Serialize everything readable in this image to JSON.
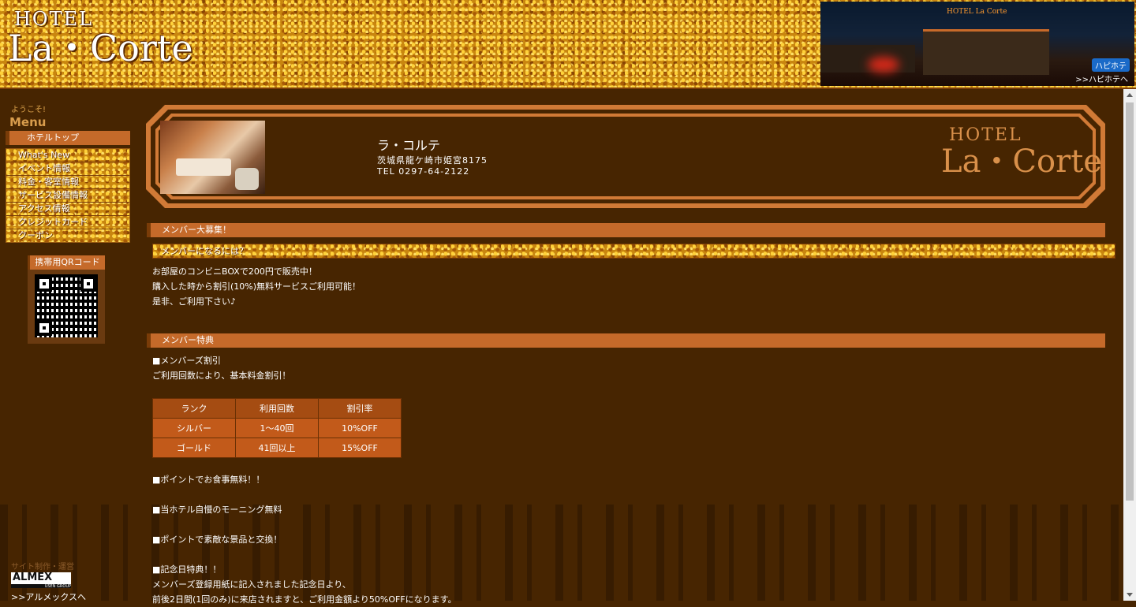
{
  "header": {
    "logo_line1": "HOTEL",
    "logo_line2": "La・Corte",
    "banner_sign": "HOTEL La Corte",
    "banner_badge": "ハピホテ",
    "banner_link": ">>ハピホテへ"
  },
  "sidebar": {
    "welcome": "ようこそ!",
    "menu_title": "Menu",
    "top_item": "ホテルトップ",
    "items": [
      {
        "label": "What's New"
      },
      {
        "label": "イベント情報"
      },
      {
        "label": "料金・客室情報"
      },
      {
        "label": "サービス設備情報"
      },
      {
        "label": "アクセス情報"
      },
      {
        "label": "クレジットカード"
      },
      {
        "label": "クーポン"
      }
    ],
    "qr_title": "携帯用QRコード"
  },
  "credit": {
    "label": "サイト制作・運営",
    "logo_text": "ALMEX",
    "logo_sub": "USEN GROUP",
    "link": ">>アルメックスへ"
  },
  "hotel": {
    "name": "ラ・コルテ",
    "address": "茨城県龍ケ崎市姫宮8175",
    "tel": "TEL 0297-64-2122",
    "logo_line1": "HOTEL",
    "logo_line2": "La・Corte"
  },
  "sections": {
    "recruit_title": "メンバー大募集！",
    "recruit_sub": "メンバーになるには？",
    "recruit_lines": [
      "お部屋のコンビニBOXで200円で販売中！",
      "購入した時から割引(10%)無料サービスご利用可能！",
      "是非、ご利用下さい♪"
    ],
    "benefit_title": "メンバー特典",
    "discount_heading": "■メンバーズ割引",
    "discount_desc": "ご利用回数により、基本料金割引！",
    "table": {
      "headers": [
        "ランク",
        "利用回数",
        "割引率"
      ],
      "rows": [
        [
          "シルバー",
          "1～40回",
          "10%OFF"
        ],
        [
          "ゴールド",
          "41回以上",
          "15%OFF"
        ]
      ]
    },
    "point_meal": "■ポイントでお食事無料！！",
    "morning": "■当ホテル自慢のモーニング無料",
    "point_prize": "■ポイントで素敵な景品と交換！",
    "anniv_heading": "■記念日特典！！",
    "anniv_line1": "メンバーズ登録用紙に記入されました記念日より、",
    "anniv_line2": "前後2日間(1回のみ)に来店されますと、ご利用金額より50%OFFになります。"
  },
  "colors": {
    "background": "#472501",
    "accent_bar": "#c56a2a",
    "table_header": "#a54c12",
    "table_row": "#c25a1a"
  }
}
